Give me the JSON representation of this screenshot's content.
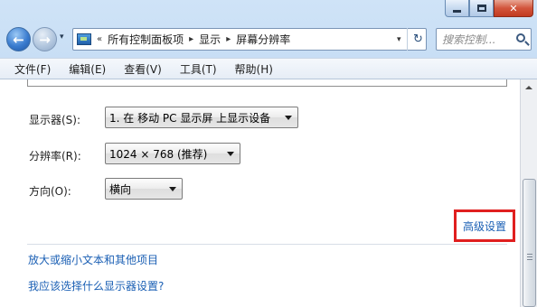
{
  "window": {
    "caption": {
      "minimize": "—",
      "maximize": "□",
      "close": "✕"
    }
  },
  "navigation": {
    "back_icon": "back-arrow-icon",
    "forward_icon": "forward-arrow-icon",
    "back_glyph": "←",
    "forward_glyph": "→",
    "history_glyph": "▾"
  },
  "address_bar": {
    "overflow": "«",
    "separator": "▸",
    "breadcrumbs": [
      "所有控制面板项",
      "显示",
      "屏幕分辨率"
    ],
    "dropdown_glyph": "▾",
    "refresh_glyph": "↻"
  },
  "search": {
    "placeholder": "搜索控制..."
  },
  "menu": {
    "items": [
      "文件(F)",
      "编辑(E)",
      "查看(V)",
      "工具(T)",
      "帮助(H)"
    ]
  },
  "settings": {
    "display_label": "显示器(S):",
    "display_value": "1. 在 移动 PC 显示屏 上显示设备",
    "resolution_label": "分辨率(R):",
    "resolution_value": "1024 × 768 (推荐)",
    "orientation_label": "方向(O):",
    "orientation_value": "横向",
    "advanced_link": "高级设置"
  },
  "links": {
    "text_size": "放大或缩小文本和其他项目",
    "which_settings": "我应该选择什么显示器设置?"
  },
  "colors": {
    "link": "#1a5fb4",
    "highlight_box": "#e01f1f",
    "window_frame": "#b9d4f0"
  }
}
